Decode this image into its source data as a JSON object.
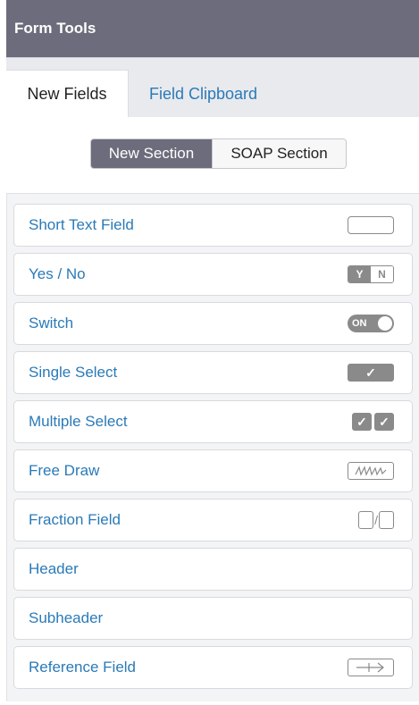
{
  "panel": {
    "title": "Form Tools"
  },
  "tabs": [
    {
      "label": "New Fields",
      "active": true
    },
    {
      "label": "Field Clipboard",
      "active": false
    }
  ],
  "section_buttons": [
    {
      "label": "New Section",
      "active": true
    },
    {
      "label": "SOAP Section",
      "active": false
    }
  ],
  "fields": [
    {
      "label": "Short Text Field",
      "icon": "text-input-icon"
    },
    {
      "label": "Yes / No",
      "icon": "yes-no-icon",
      "icon_text": [
        "Y",
        "N"
      ]
    },
    {
      "label": "Switch",
      "icon": "switch-icon",
      "icon_text": "ON"
    },
    {
      "label": "Single Select",
      "icon": "single-check-icon",
      "icon_text": "✓"
    },
    {
      "label": "Multiple Select",
      "icon": "multi-check-icon",
      "icon_text": [
        "✓",
        "✓"
      ]
    },
    {
      "label": "Free Draw",
      "icon": "signature-icon"
    },
    {
      "label": "Fraction Field",
      "icon": "fraction-icon",
      "icon_text": "/"
    },
    {
      "label": "Header",
      "icon": ""
    },
    {
      "label": "Subheader",
      "icon": ""
    },
    {
      "label": "Reference Field",
      "icon": "reference-arrow-icon"
    }
  ],
  "colors": {
    "header_bg": "#6c6c7c",
    "link_blue": "#2a7ab8",
    "icon_gray": "#8a8a8a",
    "list_bg": "#f3f4f6"
  }
}
